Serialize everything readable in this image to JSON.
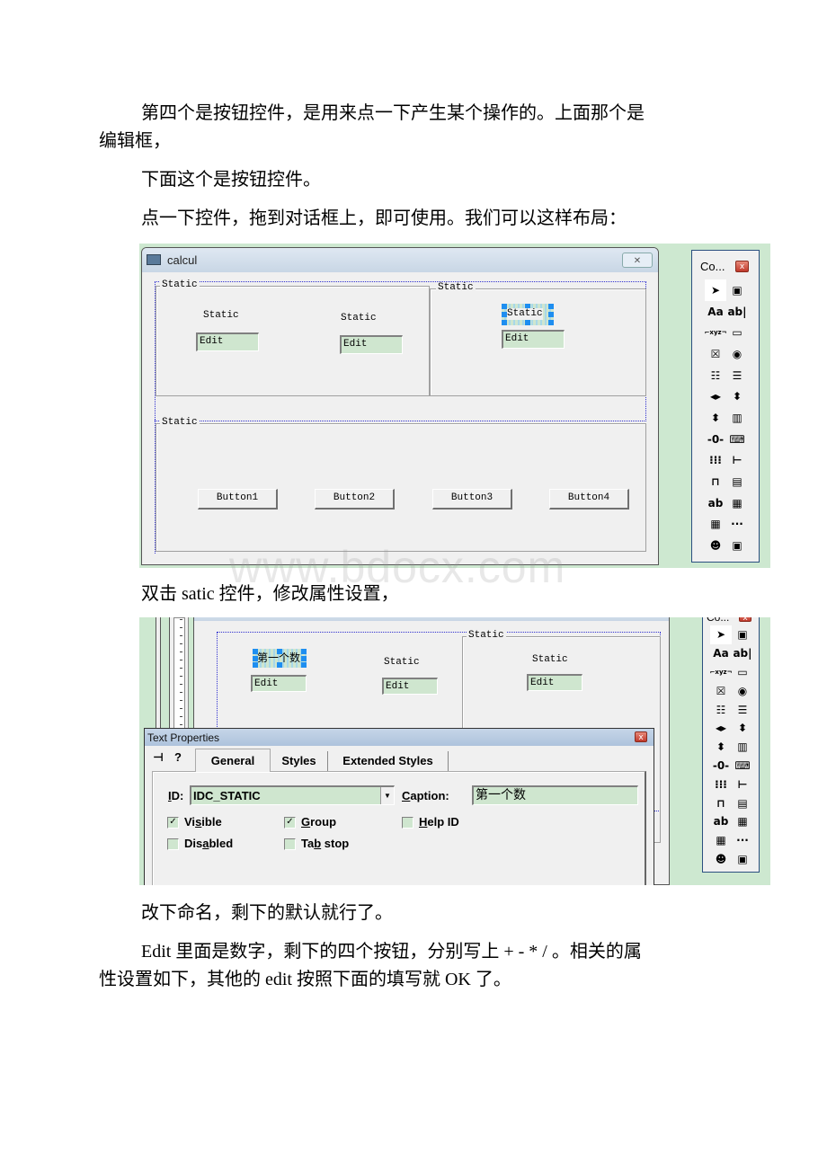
{
  "paragraphs": {
    "p1_line1": "第四个是按钮控件，是用来点一下产生某个操作的。上面那个是",
    "p1_line2": "编辑框，",
    "p2": "下面这个是按钮控件。",
    "p3": "点一下控件，拖到对话框上，即可使用。我们可以这样布局：",
    "p4": "双击 satic 控件，修改属性设置，",
    "p5": "改下命名，剩下的默认就行了。",
    "p6_line1": "Edit 里面是数字，剩下的四个按钮，分别写上 + - * / 。相关的属",
    "p6_line2": "性设置如下，其他的 edit 按照下面的填写就 OK 了。"
  },
  "watermark": "www.bdocx.com",
  "screenshot1": {
    "window_title": "calcul",
    "close_glyph": "✕",
    "groups": [
      "Static",
      "Static",
      "Static"
    ],
    "statics": [
      "Static",
      "Static",
      "Static"
    ],
    "edits": [
      "Edit",
      "Edit",
      "Edit"
    ],
    "buttons": [
      "Button1",
      "Button2",
      "Button3",
      "Button4"
    ]
  },
  "controls_toolbox": {
    "title": "Co...",
    "close_glyph": "x",
    "tools": [
      {
        "name": "pointer",
        "glyph": "➤"
      },
      {
        "name": "picture",
        "glyph": "▣"
      },
      {
        "name": "static-text",
        "glyph": "Aa"
      },
      {
        "name": "edit-box",
        "glyph": "ab|"
      },
      {
        "name": "group-box",
        "glyph": "⌐xyz¬"
      },
      {
        "name": "button",
        "glyph": "▭"
      },
      {
        "name": "check-box",
        "glyph": "☒"
      },
      {
        "name": "radio-button",
        "glyph": "◉"
      },
      {
        "name": "combo-box",
        "glyph": "☷"
      },
      {
        "name": "list-box",
        "glyph": "☰"
      },
      {
        "name": "horizontal-scrollbar",
        "glyph": "◂▸"
      },
      {
        "name": "vertical-scrollbar",
        "glyph": "⬍"
      },
      {
        "name": "spin",
        "glyph": "⬍"
      },
      {
        "name": "progress",
        "glyph": "▥"
      },
      {
        "name": "slider",
        "glyph": "-0-"
      },
      {
        "name": "hot-key",
        "glyph": "⌨"
      },
      {
        "name": "list-control",
        "glyph": "⁝⁝⁝"
      },
      {
        "name": "tree-control",
        "glyph": "⊢"
      },
      {
        "name": "tab-control",
        "glyph": "⊓"
      },
      {
        "name": "animate",
        "glyph": "▤"
      },
      {
        "name": "rich-edit",
        "glyph": "ab"
      },
      {
        "name": "date-time-picker",
        "glyph": "▦"
      },
      {
        "name": "month-calendar",
        "glyph": "▦"
      },
      {
        "name": "ip-address",
        "glyph": "···"
      },
      {
        "name": "custom-control",
        "glyph": "☻"
      },
      {
        "name": "extended-combo",
        "glyph": "▣"
      }
    ]
  },
  "screenshot2": {
    "selected_static": "第一个数",
    "statics": [
      "Static",
      "Static"
    ],
    "group": "Static",
    "edits": [
      "Edit",
      "Edit",
      "Edit"
    ],
    "properties": {
      "title": "Text Properties",
      "pin_glyph": "⊣",
      "help_glyph": "?",
      "tabs": [
        "General",
        "Styles",
        "Extended Styles"
      ],
      "active_tab": "General",
      "id_label": "ID:",
      "id_value": "IDC_STATIC",
      "caption_label": "Caption:",
      "caption_value": "第一个数",
      "checkboxes": [
        {
          "label": "Visible",
          "checked": true
        },
        {
          "label": "Group",
          "checked": true
        },
        {
          "label": "Help ID",
          "checked": false
        },
        {
          "label": "Disabled",
          "checked": false
        },
        {
          "label": "Tab stop",
          "checked": false
        }
      ]
    }
  }
}
